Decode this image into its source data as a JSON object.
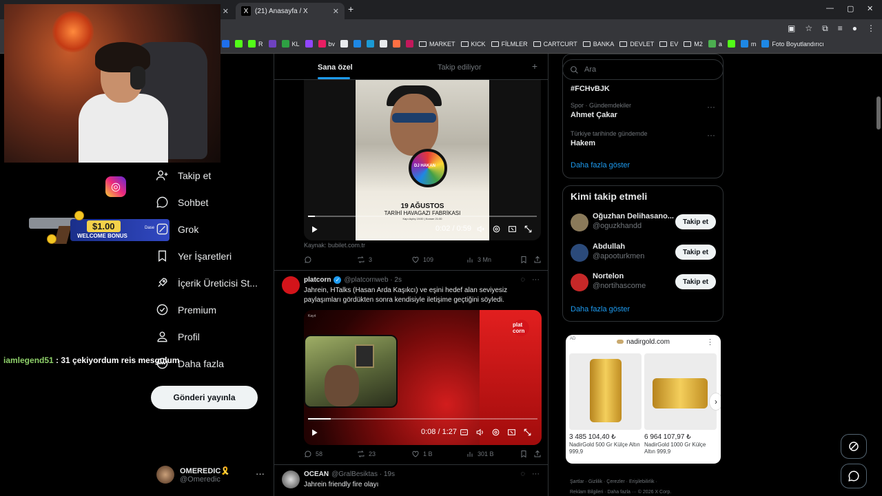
{
  "browser": {
    "tabs": [
      {
        "title": "(21) Anasayfa / X"
      }
    ],
    "new_tab_label": "+",
    "window_controls": [
      "—",
      "▢",
      "✕"
    ],
    "bookmarks": [
      {
        "label": "",
        "color": "#1f6feb"
      },
      {
        "label": "",
        "color": "#53fc18"
      },
      {
        "label": "R",
        "color": "#53fc18"
      },
      {
        "label": "",
        "color": "#6f42c1"
      },
      {
        "label": "KL",
        "color": "#2ea043"
      },
      {
        "label": "",
        "color": "#9146ff"
      },
      {
        "label": "bv",
        "color": "#e91e63"
      },
      {
        "label": "",
        "color": "#e8eaed"
      },
      {
        "label": "",
        "color": "#1e88e5"
      },
      {
        "label": "",
        "color": "#1b9ad4"
      },
      {
        "label": "",
        "color": "#e8eaed"
      },
      {
        "label": "",
        "color": "#ff7043"
      },
      {
        "label": "",
        "color": "#c2185b"
      },
      {
        "label": "MARKET",
        "folder": true
      },
      {
        "label": "KICK",
        "folder": true
      },
      {
        "label": "FİLMLER",
        "folder": true
      },
      {
        "label": "CARTCURT",
        "folder": true
      },
      {
        "label": "BANKA",
        "folder": true
      },
      {
        "label": "DEVLET",
        "folder": true
      },
      {
        "label": "EV",
        "folder": true
      },
      {
        "label": "M2",
        "folder": true
      },
      {
        "label": "a",
        "color": "#4caf50"
      },
      {
        "label": "",
        "color": "#53fc18"
      },
      {
        "label": "m",
        "color": "#1e88e5"
      },
      {
        "label": "Foto Boyutlandırıcı",
        "color": "#1e88e5"
      }
    ]
  },
  "overlay": {
    "bonus_amount": "$1.00",
    "bonus_label": "WELCOME BONUS",
    "bonus_brand": "Dase",
    "chat_user": "iamlegend51",
    "chat_message": ": 31 çekiyordum reis mesgulum"
  },
  "nav": {
    "items": [
      {
        "label": "Takip et",
        "icon": "person-plus-icon"
      },
      {
        "label": "Sohbet",
        "icon": "chat-bubble-icon"
      },
      {
        "label": "Grok",
        "icon": "grok-icon"
      },
      {
        "label": "Yer İşaretleri",
        "icon": "bookmark-icon"
      },
      {
        "label": "İçerik Üreticisi St...",
        "icon": "rocket-icon"
      },
      {
        "label": "Premium",
        "icon": "verified-badge-icon"
      },
      {
        "label": "Profil",
        "icon": "person-icon"
      },
      {
        "label": "Daha fazla",
        "icon": "more-circle-icon"
      }
    ],
    "post_button": "Gönderi yayınla",
    "account": {
      "name": "OMEREDIC🎗️",
      "handle": "@Omeredic",
      "more": "···"
    }
  },
  "timeline": {
    "tab_for_you": "Sana özel",
    "tab_following": "Takip ediliyor",
    "add_label": "+",
    "posts": [
      {
        "media": {
          "poster_date": "19 AĞUSTOS",
          "poster_sub": "TARİHİ HAVAGAZI FABRİKASI",
          "poster_small": "Kapı Açılış 19:00 | Konser 21:00",
          "poster_logo": "DJ HAKAN",
          "time": "0:02 / 0:59",
          "progress": 0.03
        },
        "source": "Kaynak: bubilet.com.tr",
        "replies": "",
        "reposts": "3",
        "likes": "109",
        "views": "3 Mn"
      },
      {
        "author": "platcorn",
        "handle": "@platcornweb · 2s",
        "text": "Jahrein, HTalks (Hasan Arda Kaşıkcı) ve eşini hedef alan seviyesiz paylaşımları gördükten sonra kendisiyle iletişime geçtiğini söyledi.",
        "media": {
          "time": "0:08 / 1:27",
          "progress": 0.1,
          "watermark": "plat corn",
          "tag": "Kayıt"
        },
        "replies": "58",
        "reposts": "23",
        "likes": "1 B",
        "views": "301 B"
      },
      {
        "author": "OCEAN",
        "handle": "@GralBesiktas · 19s",
        "text": "Jahrein friendly fire olayı"
      }
    ]
  },
  "sidebar": {
    "search_placeholder": "Ara",
    "trends": [
      {
        "category": "",
        "title": "#FCHvBJK"
      },
      {
        "category": "Spor · Gündemdekiler",
        "title": "Ahmet Çakar"
      },
      {
        "category": "Türkiye tarihinde gündemde",
        "title": "Hakem"
      }
    ],
    "trends_more": "Daha fazla göster",
    "who_to_follow_title": "Kimi takip etmeli",
    "who_to_follow": [
      {
        "name": "Oğuzhan Delihasano...",
        "handle": "@oguzkhandd",
        "button": "Takip et",
        "avatar_color": "#8a7a5a"
      },
      {
        "name": "Abdullah",
        "handle": "@apooturkmen",
        "button": "Takip et",
        "avatar_color": "#2b4a7a"
      },
      {
        "name": "Nortelon",
        "handle": "@nortihascome",
        "button": "Takip et",
        "avatar_color": "#c62828"
      }
    ],
    "who_more": "Daha fazla göster",
    "ad": {
      "label": "AD",
      "site": "nadirgold.com",
      "products": [
        {
          "price": "3 485 104,40 ₺",
          "name": "NadirGold 500 Gr Külçe Altın 999,9"
        },
        {
          "price": "6 964 107,97 ₺",
          "name": "NadirGold 1000 Gr Külçe Altın 999,9"
        }
      ]
    },
    "footer_line1": "Şartlar  ·  Gizlilik  ·  Çerezler  ·  Erişilebilirlik  ·",
    "footer_line2": "Reklam Bilgileri  ·  Daha fazla ···  © 2026 X Corp."
  }
}
